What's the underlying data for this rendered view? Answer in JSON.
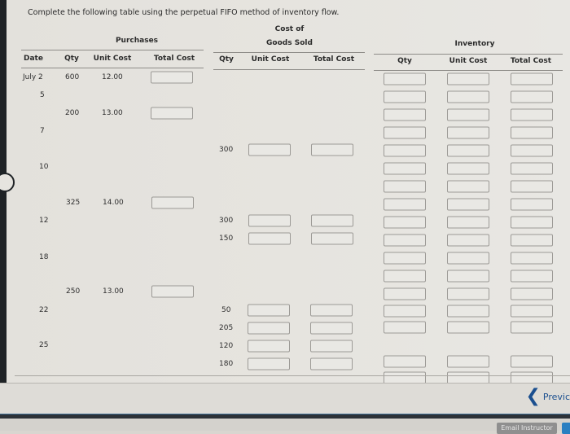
{
  "instruction": "Complete the following table using the perpetual FIFO method of inventory flow.",
  "headers": {
    "purchases": "Purchases",
    "cogs_line1": "Cost of",
    "cogs_line2": "Goods Sold",
    "inventory": "Inventory",
    "date": "Date",
    "qty": "Qty",
    "unit_cost": "Unit Cost",
    "total_cost": "Total Cost"
  },
  "dates": [
    "July 2",
    "5",
    "7",
    "10",
    "12",
    "18",
    "22",
    "25"
  ],
  "purchases": [
    {
      "qty": "600",
      "unit_cost": "12.00"
    },
    {
      "qty": "200",
      "unit_cost": "13.00"
    },
    {
      "qty": "325",
      "unit_cost": "14.00"
    },
    {
      "qty": "250",
      "unit_cost": "13.00"
    }
  ],
  "cogs_qty": [
    "300",
    "300",
    "150",
    "50",
    "205",
    "120",
    "180"
  ],
  "footer": {
    "previous_label": "Previc",
    "email_instructor_label": "Email Instructor"
  }
}
